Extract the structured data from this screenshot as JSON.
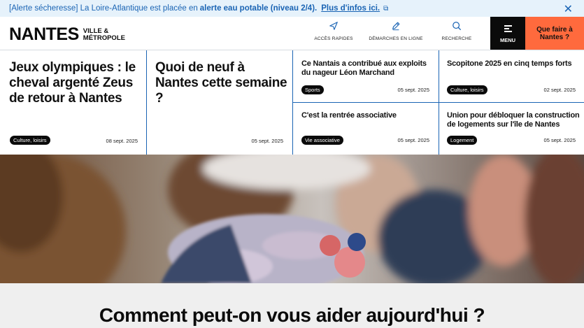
{
  "alert": {
    "prefix": "[Alerte sécheresse] La Loire-Atlantique est placée en",
    "highlight": "alerte eau potable (niveau 2/4).",
    "link": "Plus d'infos ici.",
    "close_icon": "close-icon"
  },
  "header": {
    "logo_main": "NANTES",
    "logo_sub_1": "VILLE &",
    "logo_sub_2": "MÉTROPOLE",
    "nav": [
      {
        "label": "ACCÈS RAPIDES",
        "icon": "send-icon"
      },
      {
        "label": "DÉMARCHES EN LIGNE",
        "icon": "pencil-icon"
      },
      {
        "label": "RECHERCHE",
        "icon": "search-icon"
      }
    ],
    "menu_label": "MENU",
    "quefaire_1": "Que faire à",
    "quefaire_2": "Nantes ?"
  },
  "news": [
    {
      "title": "Jeux olympiques : le cheval argenté Zeus de retour à Nantes",
      "tag": "Culture, loisirs",
      "date": "08 sept. 2025"
    },
    {
      "title": "Quoi de neuf à Nantes cette semaine ?",
      "tag": "",
      "date": "05 sept. 2025"
    },
    {
      "title": "Ce Nantais a contribué aux exploits du nageur Léon Marchand",
      "tag": "Sports",
      "date": "05 sept. 2025"
    },
    {
      "title": "Scopitone 2025 en cinq temps forts",
      "tag": "Culture, loisirs",
      "date": "02 sept. 2025"
    },
    {
      "title": "C'est la rentrée associative",
      "tag": "Vie associative",
      "date": "05 sept. 2025"
    },
    {
      "title": "Union pour débloquer la construction de logements sur l'île de Nantes",
      "tag": "Logement",
      "date": "05 sept. 2025"
    }
  ],
  "help_title": "Comment peut-on vous aider aujourd'hui ?",
  "colors": {
    "accent_blue": "#1a64b4",
    "orange": "#ff6a3d",
    "black": "#0b0b0b"
  }
}
